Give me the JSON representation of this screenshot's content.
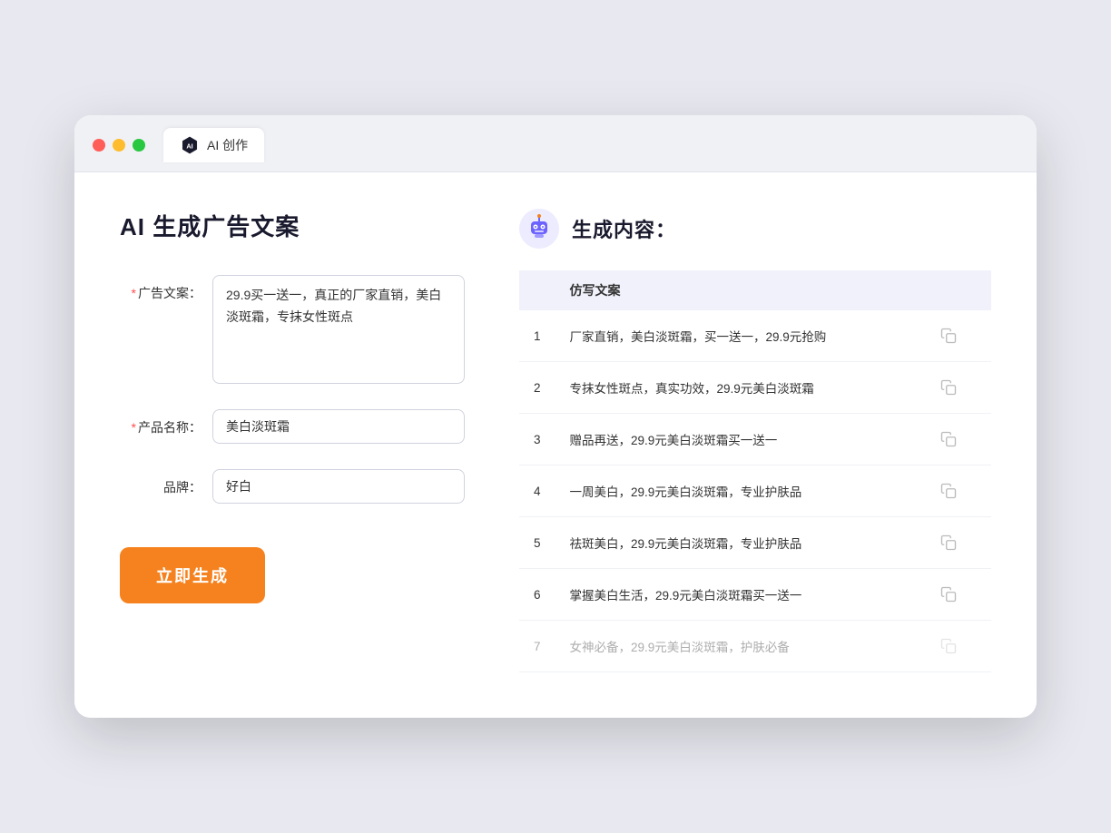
{
  "window": {
    "tab_label": "AI 创作"
  },
  "left": {
    "title": "AI 生成广告文案",
    "fields": [
      {
        "id": "ad_copy",
        "label": "广告文案：",
        "required": true,
        "type": "textarea",
        "value": "29.9买一送一，真正的厂家直销，美白淡斑霜，专抹女性斑点"
      },
      {
        "id": "product_name",
        "label": "产品名称：",
        "required": true,
        "type": "input",
        "value": "美白淡斑霜"
      },
      {
        "id": "brand",
        "label": "品牌：",
        "required": false,
        "type": "input",
        "value": "好白"
      }
    ],
    "button_label": "立即生成"
  },
  "right": {
    "title": "生成内容：",
    "table_header": "仿写文案",
    "results": [
      {
        "num": "1",
        "text": "厂家直销，美白淡斑霜，买一送一，29.9元抢购"
      },
      {
        "num": "2",
        "text": "专抹女性斑点，真实功效，29.9元美白淡斑霜"
      },
      {
        "num": "3",
        "text": "赠品再送，29.9元美白淡斑霜买一送一"
      },
      {
        "num": "4",
        "text": "一周美白，29.9元美白淡斑霜，专业护肤品"
      },
      {
        "num": "5",
        "text": "祛斑美白，29.9元美白淡斑霜，专业护肤品"
      },
      {
        "num": "6",
        "text": "掌握美白生活，29.9元美白淡斑霜买一送一"
      },
      {
        "num": "7",
        "text": "女神必备，29.9元美白淡斑霜，护肤必备",
        "faded": true
      }
    ]
  }
}
